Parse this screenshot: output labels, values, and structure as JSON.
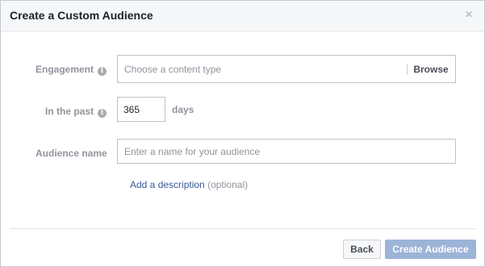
{
  "dialog": {
    "title": "Create a Custom Audience",
    "close_glyph": "×"
  },
  "form": {
    "engagement": {
      "label": "Engagement",
      "info_icon": "info-icon",
      "placeholder": "Choose a content type",
      "browse_label": "Browse"
    },
    "in_the_past": {
      "label": "In the past",
      "info_icon": "info-icon",
      "value": "365",
      "unit": "days"
    },
    "audience_name": {
      "label": "Audience name",
      "placeholder": "Enter a name for your audience"
    },
    "description": {
      "link_label": "Add a description",
      "optional_label": "(optional)"
    }
  },
  "footer": {
    "back_label": "Back",
    "create_label": "Create Audience"
  },
  "colors": {
    "accent_disabled": "#9cb4d8",
    "link": "#365899",
    "label_gray": "#90949c"
  }
}
